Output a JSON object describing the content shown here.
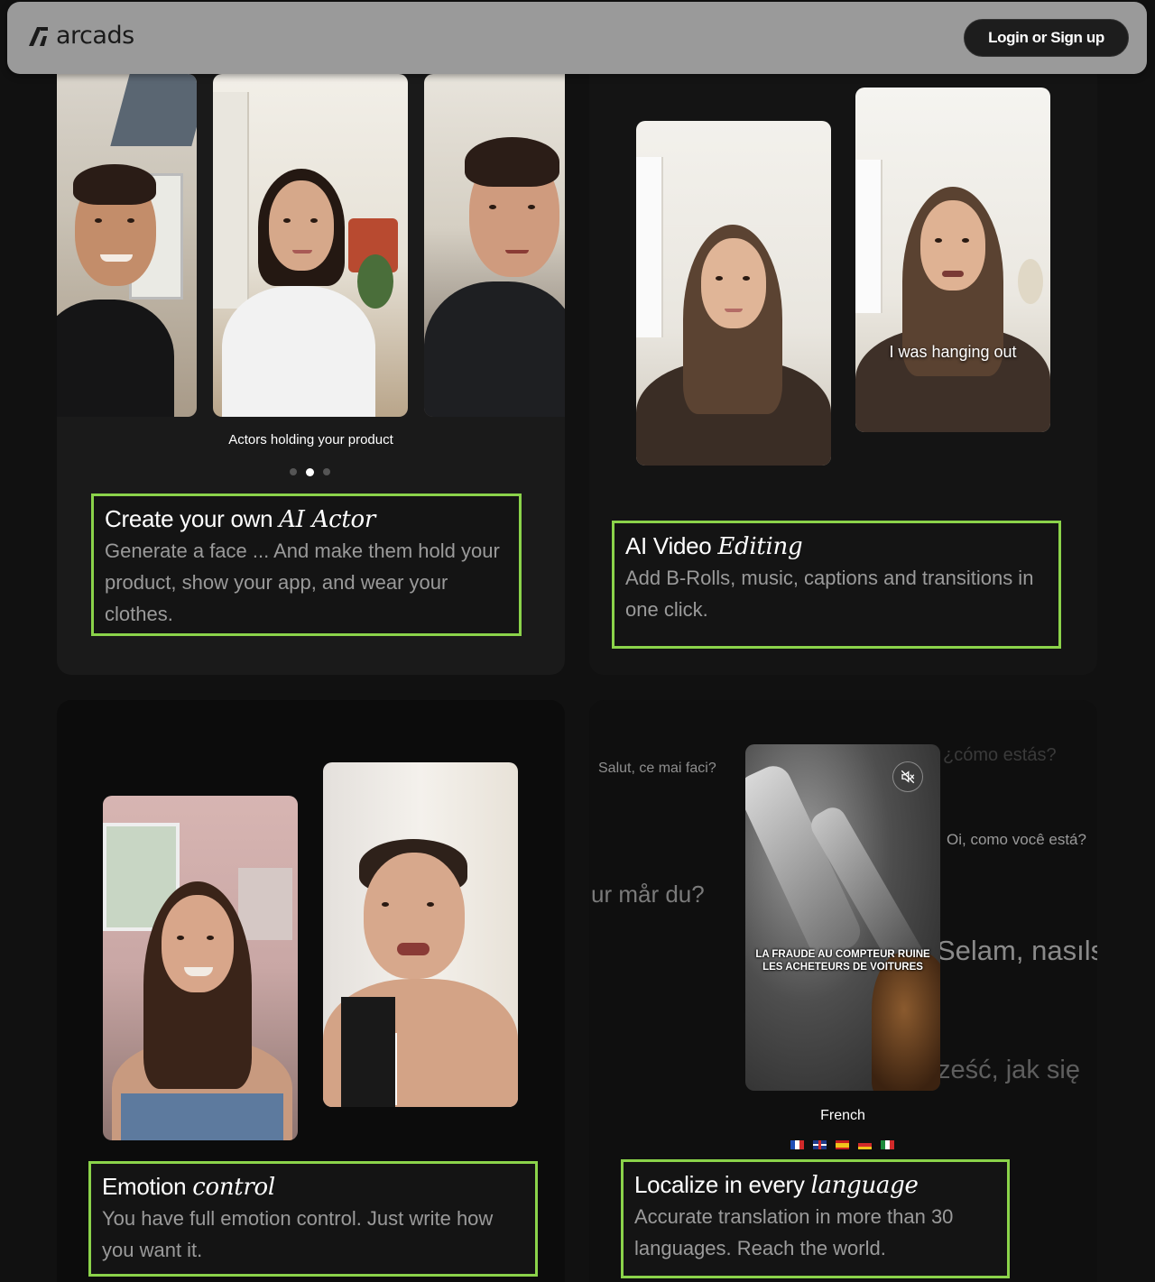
{
  "header": {
    "brand": "arcads",
    "login_label": "Login or Sign up"
  },
  "card_actor": {
    "caption": "Actors holding your product",
    "carousel_pages": 3,
    "carousel_active": 2,
    "title_plain": "Create your own ",
    "title_italic": "AI Actor",
    "description": "Generate a face ... And make them hold your product, show your app, and wear your clothes."
  },
  "card_editing": {
    "subtitle": "I was hanging out",
    "title_plain": "AI Video ",
    "title_italic": "Editing",
    "description": "Add B-Rolls, music, captions and transitions in one click."
  },
  "card_emotion": {
    "title_plain": "Emotion ",
    "title_italic": "control",
    "description": "You have full emotion control. Just write how you want it."
  },
  "card_localize": {
    "floating_phrases": [
      "Salut, ce mai faci?",
      "¿cómo estás?",
      "Oi, como você está?",
      "ur mår du?",
      "Selam, nasıls",
      "ześć, jak się"
    ],
    "video_caption_line1": "LA FRAUDE AU COMPTEUR RUINE",
    "video_caption_line2": "LES ACHETEURS DE VOITURES",
    "language_label": "French",
    "flags": [
      "france",
      "uk",
      "spain",
      "germany",
      "italy"
    ],
    "title_plain": "Localize in every ",
    "title_italic": "language",
    "description": "Accurate translation in more than 30 languages. Reach the world."
  },
  "colors": {
    "accent_border": "#8bd34a",
    "header_bg": "#9a9a9a",
    "page_bg": "#111111"
  }
}
